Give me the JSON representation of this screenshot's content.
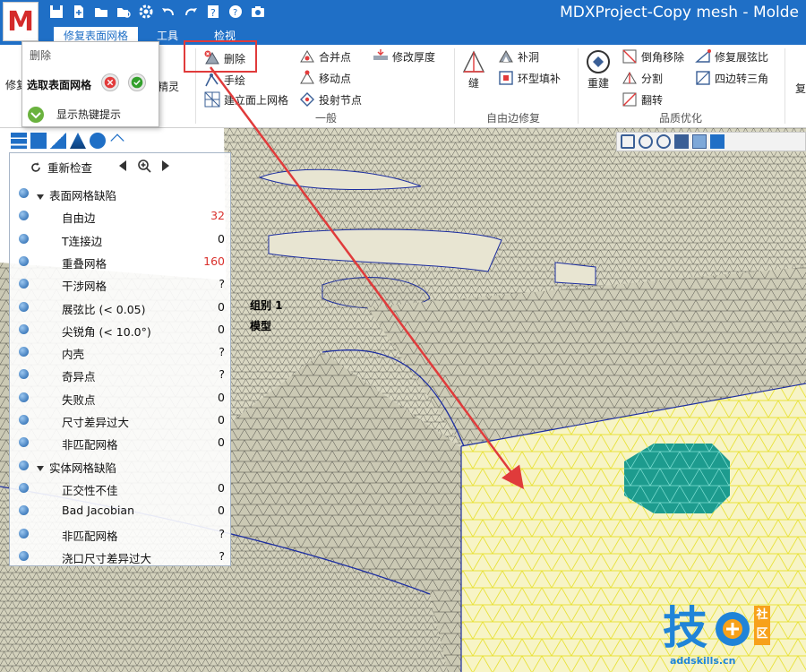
{
  "app": {
    "logo_letter": "M",
    "title": "MDXProject-Copy mesh - Molde",
    "brand_color": "#1f6fc6"
  },
  "quick_access": {
    "icons": [
      "save-icon",
      "new-icon",
      "open-folder-icon",
      "find-icon",
      "settings-icon",
      "undo-icon",
      "redo-icon",
      "help-book-icon",
      "help-icon",
      "screenshot-icon"
    ]
  },
  "tabs": [
    {
      "label": "修复表面网格",
      "active": true
    },
    {
      "label": "工具",
      "active": false
    },
    {
      "label": "检视",
      "active": false
    }
  ],
  "ribbon": {
    "left_partial": {
      "repair": "修复",
      "refine": "精灵"
    },
    "general": {
      "delete": "删除",
      "hand_draw": "手绘",
      "build_mesh": "建立面上网格",
      "merge_nodes": "合并点",
      "move_nodes": "移动点",
      "project_nodes": "投射节点",
      "modify_thickness": "修改厚度",
      "group_label": "一般"
    },
    "free_edge": {
      "seam": "缝",
      "patch_hole": "补洞",
      "ring_fill": "环型填补",
      "group_label": "自由边修复"
    },
    "quality": {
      "rebuild": "重建",
      "chamfer_remove": "倒角移除",
      "split": "分割",
      "flip": "翻转",
      "fix_aspect": "修复展弦比",
      "quad_to_tri": "四边转三角",
      "group_label": "品质优化"
    },
    "right_partial": {
      "label": "复"
    }
  },
  "popup": {
    "title": "删除",
    "select_label": "选取表面网格",
    "cancel_icon": "cancel-icon",
    "confirm_icon": "confirm-icon",
    "hotkey_label": "显示热键提示"
  },
  "viewport": {
    "group_label": "组别 1",
    "model_label": "模型"
  },
  "diagnostics": {
    "recheck": "重新检查",
    "categories": [
      {
        "label": "表面网格缺陷",
        "items": [
          {
            "label": "自由边",
            "value": "32",
            "color": "#d9302c"
          },
          {
            "label": "T连接边",
            "value": "0",
            "color": "#111111"
          },
          {
            "label": "重叠网格",
            "value": "160",
            "color": "#d9302c"
          },
          {
            "label": "干涉网格",
            "value": "?",
            "color": "#111111"
          },
          {
            "label": "展弦比 (< 0.05)",
            "value": "0",
            "color": "#111111"
          },
          {
            "label": "尖锐角 (< 10.0°)",
            "value": "0",
            "color": "#111111"
          },
          {
            "label": "内壳",
            "value": "?",
            "color": "#111111"
          },
          {
            "label": "奇异点",
            "value": "?",
            "color": "#111111"
          },
          {
            "label": "失败点",
            "value": "0",
            "color": "#111111"
          },
          {
            "label": "尺寸差异过大",
            "value": "0",
            "color": "#111111"
          },
          {
            "label": "非匹配网格",
            "value": "0",
            "color": "#111111"
          }
        ]
      },
      {
        "label": "实体网格缺陷",
        "items": [
          {
            "label": "正交性不佳",
            "value": "0",
            "color": "#111111"
          },
          {
            "label": "Bad Jacobian",
            "value": "0",
            "color": "#111111"
          },
          {
            "label": "非匹配网格",
            "value": "?",
            "color": "#111111"
          },
          {
            "label": "浇口尺寸差异过大",
            "value": "?",
            "color": "#111111"
          }
        ]
      }
    ]
  },
  "watermark": {
    "char": "技",
    "side_text": "社区",
    "url": "addskills.cn"
  }
}
